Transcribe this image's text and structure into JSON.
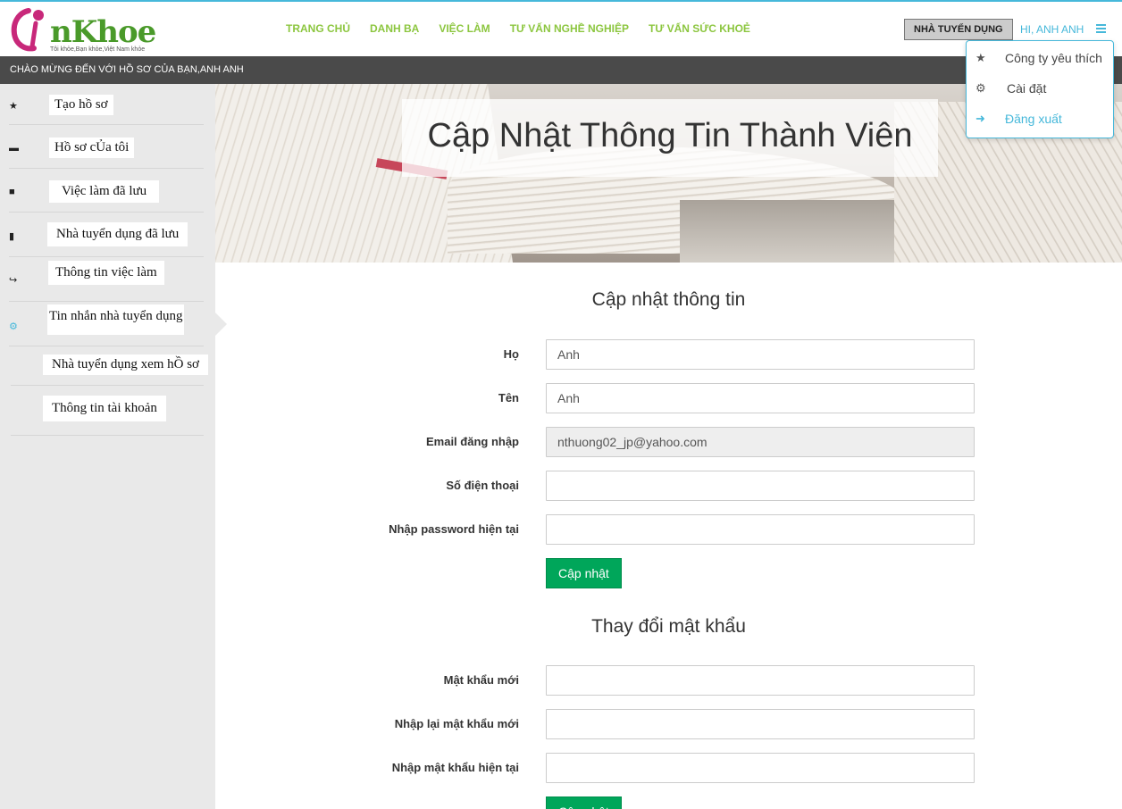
{
  "header": {
    "logo_text": "nKhoe",
    "logo_tagline": "Tôi khỏe,Bạn khỏe,Việt Nam khỏe",
    "nav": [
      "TRANG CHỦ",
      "DANH BẠ",
      "VIỆC LÀM",
      "TƯ VẤN NGHỀ NGHIỆP",
      "TƯ VẤN SỨC KHOẺ"
    ],
    "employer_button": "NHÀ TUYỂN DỤNG",
    "greeting": "HI, ANH ANH"
  },
  "welcome_text": "CHÀO MỪNG ĐẾN VỚI HỒ SƠ CỦA BẠN,ANH ANH",
  "user_menu": {
    "items": [
      {
        "label": "Công ty yêu thích",
        "icon": "star-icon"
      },
      {
        "label": "Cài đặt",
        "icon": "gears-icon"
      },
      {
        "label": "Đăng xuất",
        "icon": "sign-out-icon"
      }
    ]
  },
  "sidebar": {
    "items": [
      {
        "label": "Tạo hồ sơ",
        "icon": "star-icon"
      },
      {
        "label": "Hồ sơ cỦa tôi",
        "icon": "briefcase-icon"
      },
      {
        "label": "Việc làm đã lưu",
        "icon": "book-icon"
      },
      {
        "label": "Nhà tuyển dụng đã lưu",
        "icon": "bookmark-icon"
      },
      {
        "label": "Thông tin việc làm",
        "icon": "share-icon"
      },
      {
        "label": "Tin nhắn nhà tuyển dụng",
        "icon": "gears-icon"
      },
      {
        "label": "Nhà tuyển dụng xem hỒ sơ",
        "icon": ""
      },
      {
        "label": "Thông tin tài khoản",
        "icon": ""
      }
    ]
  },
  "banner": {
    "title": "Cập Nhật Thông Tin Thành Viên"
  },
  "update_info": {
    "title": "Cập nhật thông tin",
    "fields": [
      {
        "label": "Họ",
        "value": "Anh"
      },
      {
        "label": "Tên",
        "value": "Anh"
      },
      {
        "label": "Email đăng nhập",
        "value": "nthuong02_jp@yahoo.com"
      },
      {
        "label": "Số điện thoại",
        "value": ""
      },
      {
        "label": "Nhập password hiện tại",
        "value": ""
      }
    ],
    "submit": "Cập nhật"
  },
  "change_password": {
    "title": "Thay đổi mật khẩu",
    "fields": [
      {
        "label": "Mật khẩu mới",
        "value": ""
      },
      {
        "label": "Nhập lại mật khẩu mới",
        "value": ""
      },
      {
        "label": "Nhập mật khẩu hiện tại",
        "value": ""
      }
    ],
    "submit": "Cập nhật"
  },
  "colors": {
    "accent": "#46b8da",
    "nav": "#8cc63f",
    "button": "#00a65a",
    "welcome_bar": "#4a4a4a"
  }
}
